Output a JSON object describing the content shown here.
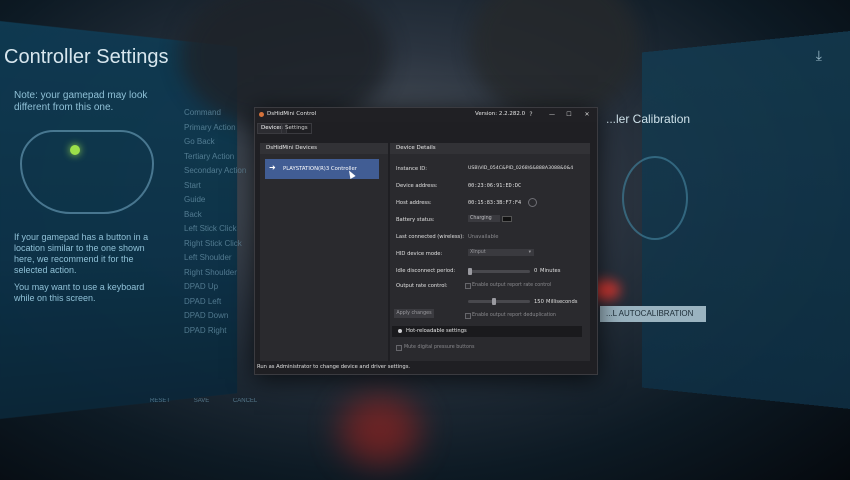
{
  "background": {
    "left_title": "Controller Settings",
    "left_note": "Note: your gamepad may look different from this one.",
    "left_hint": "If your gamepad has a button in a location similar to the one shown here, we recommend it for the selected action.",
    "left_hint2": "You may want to use a keyboard while on this screen.",
    "left_list": [
      "Command",
      "Primary Action",
      "Go Back",
      "Tertiary Action",
      "Secondary Action",
      "Start",
      "Guide",
      "Back",
      "Left Stick Click",
      "Right Stick Click",
      "Left Shoulder",
      "Right Shoulder",
      "DPAD Up",
      "DPAD Left",
      "DPAD Down",
      "DPAD Right"
    ],
    "right_title": "...ler Calibration",
    "right_button": "...L AUTOCALIBRATION",
    "bottom_buttons": [
      "RESET",
      "SAVE",
      "CANCEL"
    ]
  },
  "window": {
    "title": "DsHidMini Control",
    "version": "Version: 2.2.282.0",
    "help_label": "?",
    "minimize": "—",
    "maximize": "☐",
    "close": "✕",
    "tabs": [
      "Devices",
      "Settings"
    ],
    "devices_panel": {
      "header": "DsHidMini Devices",
      "items": [
        {
          "label": "PLAYSTATION(R)3 Controller",
          "icon": "arrow-right-icon"
        }
      ]
    },
    "details_panel": {
      "header": "Device Details",
      "instance_id_label": "Instance ID:",
      "instance_id": "USB\\VID_054C&PID_0268\\6&888A3088&0&4",
      "device_address_label": "Device address:",
      "device_address": "00:23:06:91:ED:DC",
      "host_address_label": "Host address:",
      "host_address": "00:15:83:3B:F7:F4",
      "battery_label": "Battery status:",
      "battery_value": "Charging",
      "last_connected_label": "Last connected (wireless):",
      "last_connected_value": "Unavailable",
      "hid_mode_label": "HID device mode:",
      "hid_mode_value": "XInput",
      "idle_label": "Idle disconnect period:",
      "idle_value": "0",
      "idle_unit": "Minutes",
      "output_rate_label": "Output rate control:",
      "output_rate_checkbox": "Enable output report rate control",
      "output_rate_value": "150",
      "output_rate_unit": "Milliseconds",
      "dedup_checkbox": "Enable output report deduplication",
      "apply_button": "Apply changes",
      "hot_reload_header": "Hot-reloadable settings",
      "mute_checkbox": "Mute digital pressure buttons"
    },
    "status_bar": "Run as Administrator to change device and driver settings."
  }
}
